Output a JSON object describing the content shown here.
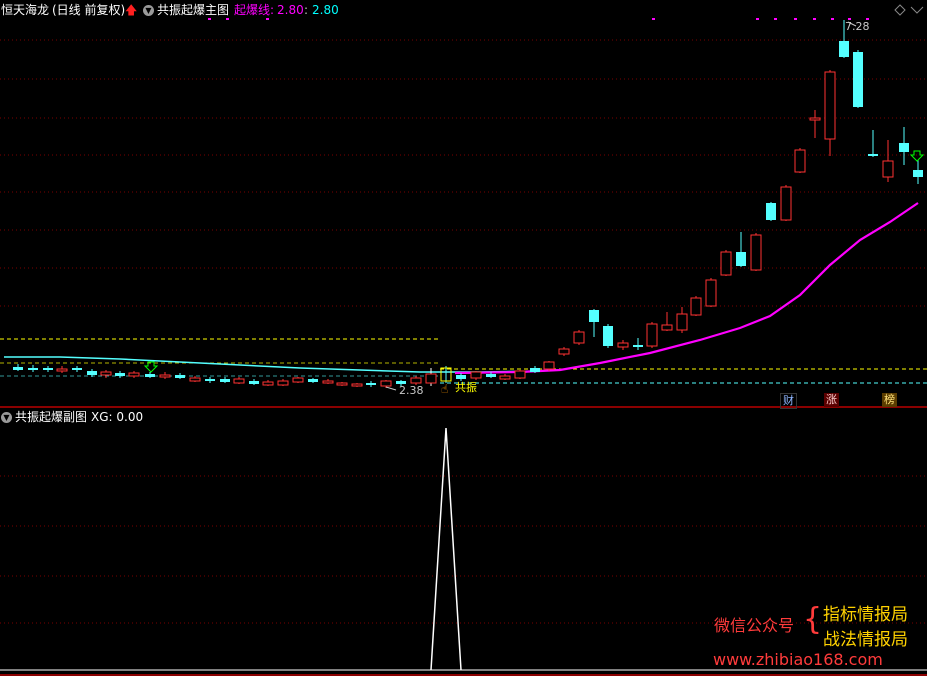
{
  "header": {
    "stock_name": "恒天海龙",
    "period": "(日线 前复权)",
    "main_indicator_name": "共振起爆主图",
    "line_label": "起爆线:",
    "line_value_1": "2.80",
    "line_value_2": "2.80"
  },
  "main_chart": {
    "high_label": "7.28",
    "low_label": "2.38",
    "signal_label": "共振",
    "badges": [
      "财",
      "涨",
      "榜"
    ]
  },
  "sub_chart": {
    "title": "共振起爆副图",
    "value_label": "XG: 0.00"
  },
  "watermark": {
    "line_left": "微信公众号",
    "line_right_1": "指标情报局",
    "line_right_2": "战法情报局",
    "url": "www.zhibiao168.com"
  },
  "colors": {
    "up": "#ff3232",
    "down": "#54ffff",
    "ma": "#ff00ff",
    "signal_line": "#00ffff",
    "dotted_grid": "#7a0000",
    "yellow_dash": "#ffff00"
  }
}
